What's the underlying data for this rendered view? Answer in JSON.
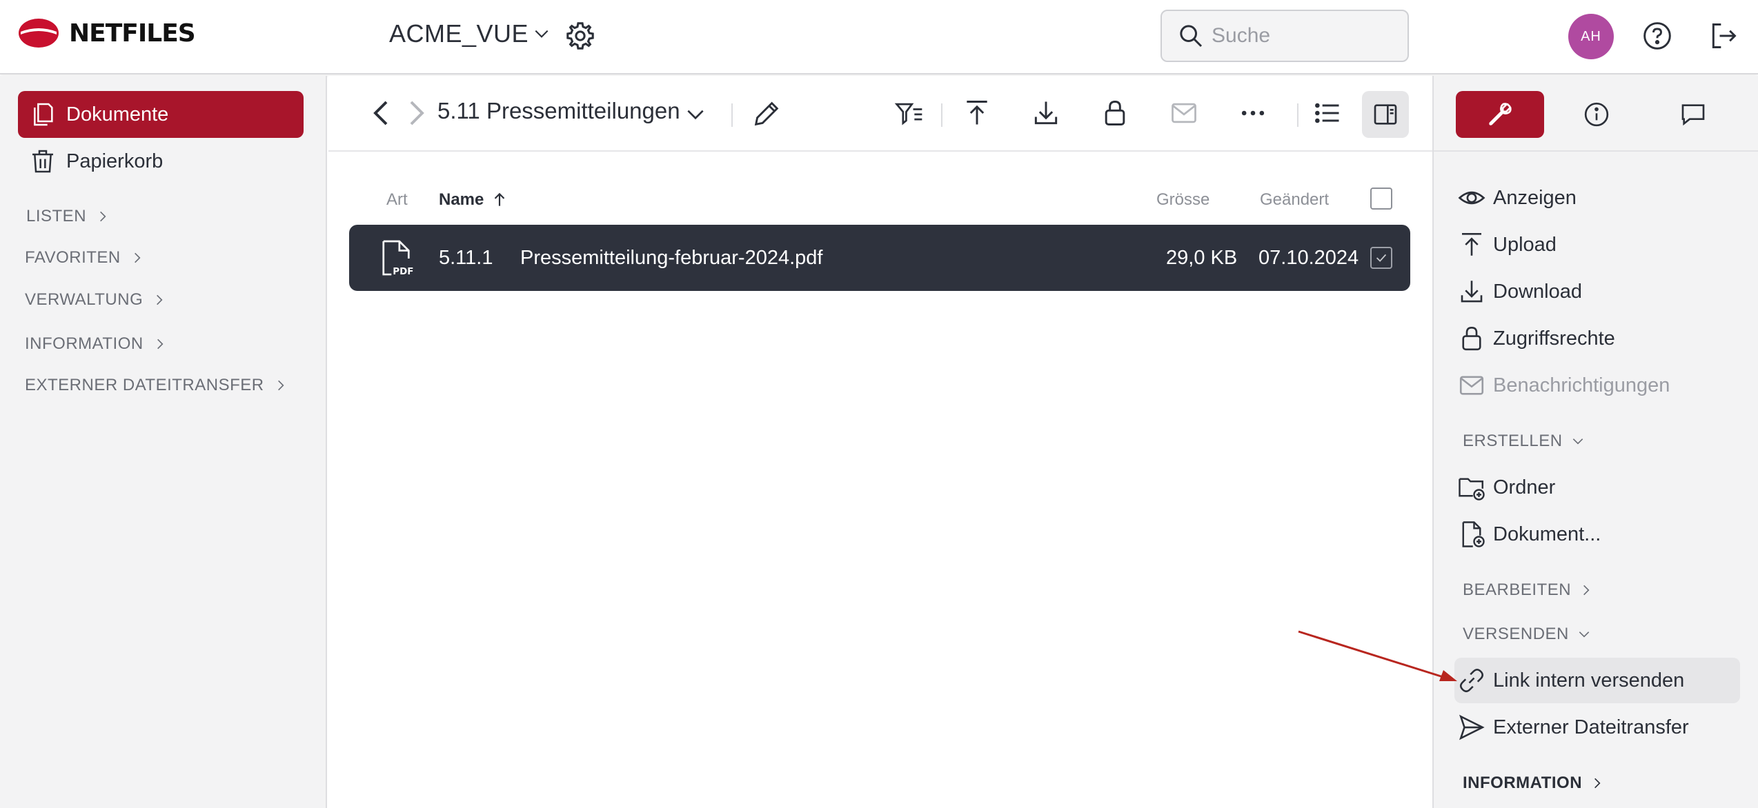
{
  "app": {
    "logo_text": "NETFILES",
    "brand_color": "#a8152b"
  },
  "topbar": {
    "workspace_name": "ACME_VUE",
    "search_placeholder": "Suche",
    "avatar_initials": "AH",
    "avatar_color": "#b04aa0"
  },
  "sidebar": {
    "items": [
      {
        "label": "Dokumente",
        "icon": "documents-icon",
        "active": true
      },
      {
        "label": "Papierkorb",
        "icon": "trash-icon",
        "active": false
      }
    ],
    "sections": [
      {
        "label": "LISTEN"
      },
      {
        "label": "FAVORITEN"
      },
      {
        "label": "VERWALTUNG"
      },
      {
        "label": "INFORMATION"
      },
      {
        "label": "EXTERNER DATEITRANSFER"
      }
    ]
  },
  "main": {
    "breadcrumb": "5.11 Pressemitteilungen",
    "columns": {
      "type": "Art",
      "name": "Name",
      "size": "Grösse",
      "modified": "Geändert"
    },
    "rows": [
      {
        "icon": "pdf-file-icon",
        "number": "5.11.1",
        "name": "Pressemitteilung-februar-2024.pdf",
        "size": "29,0 KB",
        "modified": "07.10.2024",
        "selected": true
      }
    ]
  },
  "rpanel": {
    "actions": [
      {
        "label": "Anzeigen",
        "icon": "eye-icon"
      },
      {
        "label": "Upload",
        "icon": "upload-icon"
      },
      {
        "label": "Download",
        "icon": "download-icon"
      },
      {
        "label": "Zugriffsrechte",
        "icon": "lock-icon"
      },
      {
        "label": "Benachrichtigungen",
        "icon": "mail-icon",
        "disabled": true
      }
    ],
    "sections": {
      "erstellen": "ERSTELLEN",
      "bearbeiten": "BEARBEITEN",
      "versenden": "VERSENDEN",
      "information": "INFORMATION"
    },
    "create_items": [
      {
        "label": "Ordner",
        "icon": "folder-add-icon"
      },
      {
        "label": "Dokument...",
        "icon": "document-add-icon"
      }
    ],
    "send_items": [
      {
        "label": "Link intern versenden",
        "icon": "link-icon"
      },
      {
        "label": "Externer Dateitransfer",
        "icon": "send-icon"
      }
    ]
  }
}
